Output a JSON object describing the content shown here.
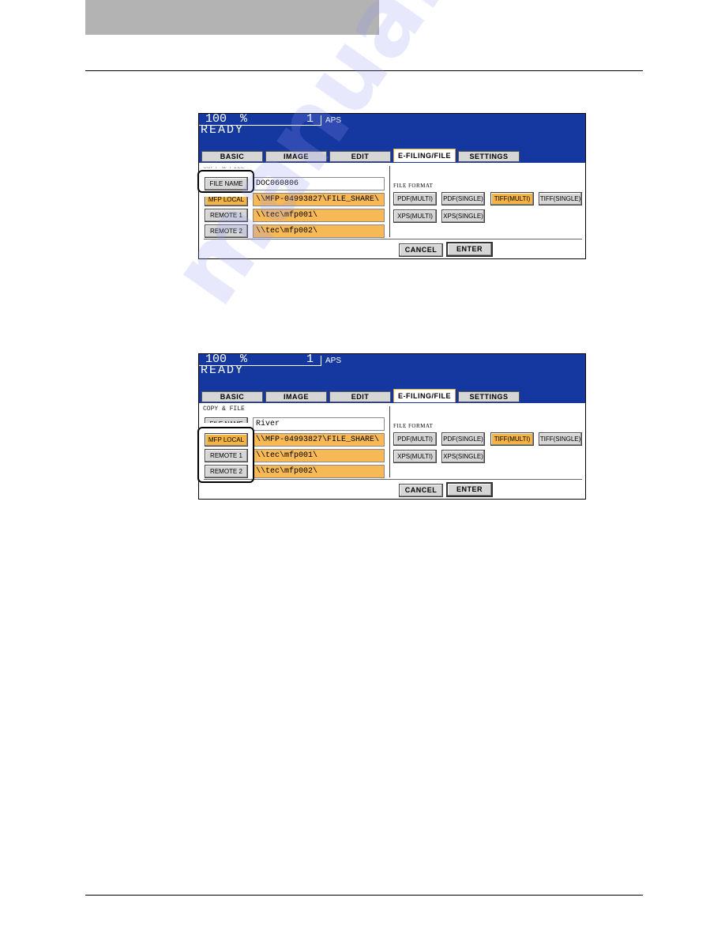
{
  "page": {
    "watermark": "manualshive.com"
  },
  "screens": [
    {
      "status": {
        "zoom": "100",
        "percent": "%",
        "copies": "1",
        "paper": "APS",
        "message": "READY"
      },
      "tabs": [
        "BASIC",
        "IMAGE",
        "EDIT",
        "E-FILING/FILE",
        "SETTINGS"
      ],
      "active_tab": "E-FILING/FILE",
      "section_label": "COPY & FILE",
      "destinations": [
        {
          "label": "FILE NAME",
          "value": "DOC060806",
          "selected": false
        },
        {
          "label": "MFP LOCAL",
          "value": "\\\\MFP-04993827\\FILE_SHARE\\",
          "selected": true
        },
        {
          "label": "REMOTE 1",
          "value": "\\\\tec\\mfp001\\",
          "selected": false
        },
        {
          "label": "REMOTE 2",
          "value": "\\\\tec\\mfp002\\",
          "selected": false
        }
      ],
      "file_format_label": "FILE FORMAT",
      "formats": [
        {
          "label": "PDF(MULTI)",
          "selected": false
        },
        {
          "label": "PDF(SINGLE)",
          "selected": false
        },
        {
          "label": "TIFF(MULTI)",
          "selected": true
        },
        {
          "label": "TIFF(SINGLE)",
          "selected": false
        },
        {
          "label": "XPS(MULTI)",
          "selected": false
        },
        {
          "label": "XPS(SINGLE)",
          "selected": false
        }
      ],
      "cancel_label": "CANCEL",
      "enter_label": "ENTER",
      "highlighted": "FILE NAME button"
    },
    {
      "status": {
        "zoom": "100",
        "percent": "%",
        "copies": "1",
        "paper": "APS",
        "message": "READY"
      },
      "tabs": [
        "BASIC",
        "IMAGE",
        "EDIT",
        "E-FILING/FILE",
        "SETTINGS"
      ],
      "active_tab": "E-FILING/FILE",
      "section_label": "COPY & FILE",
      "destinations": [
        {
          "label": "FILE NAME",
          "value": "River",
          "selected": false
        },
        {
          "label": "MFP LOCAL",
          "value": "\\\\MFP-04993827\\FILE_SHARE\\",
          "selected": true
        },
        {
          "label": "REMOTE 1",
          "value": "\\\\tec\\mfp001\\",
          "selected": false
        },
        {
          "label": "REMOTE 2",
          "value": "\\\\tec\\mfp002\\",
          "selected": false
        }
      ],
      "file_format_label": "FILE FORMAT",
      "formats": [
        {
          "label": "PDF(MULTI)",
          "selected": false
        },
        {
          "label": "PDF(SINGLE)",
          "selected": false
        },
        {
          "label": "TIFF(MULTI)",
          "selected": true
        },
        {
          "label": "TIFF(SINGLE)",
          "selected": false
        },
        {
          "label": "XPS(MULTI)",
          "selected": false
        },
        {
          "label": "XPS(SINGLE)",
          "selected": false
        }
      ],
      "cancel_label": "CANCEL",
      "enter_label": "ENTER",
      "highlighted": "MFP LOCAL / REMOTE 1 / REMOTE 2 buttons"
    }
  ]
}
